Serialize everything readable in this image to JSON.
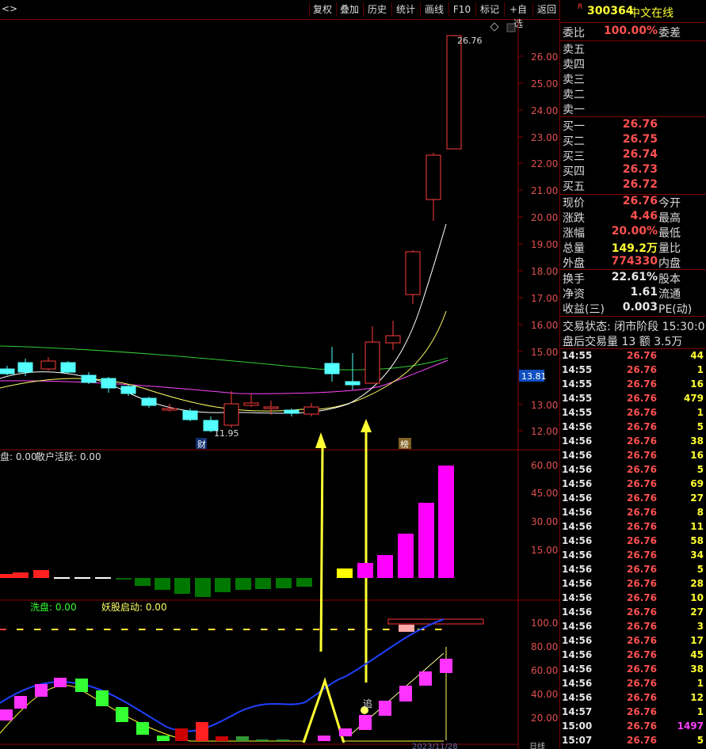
{
  "toolbar": {
    "nav_left": "<",
    "nav_right": ">",
    "buttons": [
      "复权",
      "叠加",
      "历史",
      "统计",
      "画线",
      "F10",
      "标记",
      "+自选",
      "返回"
    ]
  },
  "main_chart": {
    "price_axis": [
      "26.00",
      "25.00",
      "24.00",
      "23.00",
      "22.00",
      "21.00",
      "20.00",
      "19.00",
      "18.00",
      "17.00",
      "16.00",
      "15.00",
      "13.00",
      "12.00"
    ],
    "current_price_tag": "13.81",
    "high_label": "26.76",
    "low_label": "11.95",
    "marker_cai": "财",
    "marker_bang": "榜",
    "colors": {
      "up": "#ff3c3c",
      "down": "#54ffff",
      "ma5": "#ffffff",
      "ma10": "#ffff66",
      "ma20": "#ff44ff",
      "ma60": "#33cc33"
    }
  },
  "indicator1": {
    "label_a": "盘: 0.00",
    "label_b": "散户活跃: 0.00",
    "axis": [
      "60.00",
      "45.00",
      "30.00",
      "15.00"
    ]
  },
  "indicator2": {
    "label_a": "洗盘: 0.00",
    "label_b": "妖股启动: 0.00",
    "axis": [
      "100.0",
      "80.00",
      "60.00",
      "40.00",
      "20.00"
    ],
    "chase_label": "追",
    "date_fragment": "2023/11/28",
    "bottom_label": "日线"
  },
  "quote": {
    "code": "300364",
    "name": "中文在线",
    "r_mark": "R",
    "weibi_label": "委比",
    "weibi_value": "100.00%",
    "weicha_label": "委差",
    "sell": [
      {
        "label": "卖五",
        "price": ""
      },
      {
        "label": "卖四",
        "price": ""
      },
      {
        "label": "卖三",
        "price": ""
      },
      {
        "label": "卖二",
        "price": ""
      },
      {
        "label": "卖一",
        "price": ""
      }
    ],
    "buy": [
      {
        "label": "买一",
        "price": "26.76"
      },
      {
        "label": "买二",
        "price": "26.75"
      },
      {
        "label": "买三",
        "price": "26.74"
      },
      {
        "label": "买四",
        "price": "26.73"
      },
      {
        "label": "买五",
        "price": "26.72"
      }
    ],
    "stats": [
      {
        "label": "现价",
        "value": "26.76",
        "label2": "今开",
        "color": "#ff5050"
      },
      {
        "label": "涨跌",
        "value": "4.46",
        "label2": "最高",
        "color": "#ff5050"
      },
      {
        "label": "涨幅",
        "value": "20.00%",
        "label2": "最低",
        "color": "#ff5050"
      },
      {
        "label": "总量",
        "value": "149.2万",
        "label2": "量比",
        "color": "#ffff33"
      },
      {
        "label": "外盘",
        "value": "774330",
        "label2": "内盘",
        "color": "#ff5050"
      }
    ],
    "stats2": [
      {
        "label": "换手",
        "value": "22.61%",
        "label2": "股本",
        "color": "#e6e6e6"
      },
      {
        "label": "净资",
        "value": "1.61",
        "label2": "流通",
        "color": "#e6e6e6"
      },
      {
        "label": "收益(三)",
        "value": "0.003",
        "label2": "PE(动)",
        "color": "#e6e6e6"
      }
    ],
    "trade_status": "交易状态: 闭市阶段 15:30:0",
    "after_hours": "盘后交易量 13 额 3.5万"
  },
  "ticks": [
    {
      "time": "14:55",
      "price": "26.76",
      "vol": "44"
    },
    {
      "time": "14:55",
      "price": "26.76",
      "vol": "1"
    },
    {
      "time": "14:55",
      "price": "26.76",
      "vol": "16"
    },
    {
      "time": "14:55",
      "price": "26.76",
      "vol": "479"
    },
    {
      "time": "14:55",
      "price": "26.76",
      "vol": "1"
    },
    {
      "time": "14:56",
      "price": "26.76",
      "vol": "5"
    },
    {
      "time": "14:56",
      "price": "26.76",
      "vol": "38"
    },
    {
      "time": "14:56",
      "price": "26.76",
      "vol": "16"
    },
    {
      "time": "14:56",
      "price": "26.76",
      "vol": "5"
    },
    {
      "time": "14:56",
      "price": "26.76",
      "vol": "69"
    },
    {
      "time": "14:56",
      "price": "26.76",
      "vol": "27"
    },
    {
      "time": "14:56",
      "price": "26.76",
      "vol": "8"
    },
    {
      "time": "14:56",
      "price": "26.76",
      "vol": "11"
    },
    {
      "time": "14:56",
      "price": "26.76",
      "vol": "58"
    },
    {
      "time": "14:56",
      "price": "26.76",
      "vol": "34"
    },
    {
      "time": "14:56",
      "price": "26.76",
      "vol": "5"
    },
    {
      "time": "14:56",
      "price": "26.76",
      "vol": "28"
    },
    {
      "time": "14:56",
      "price": "26.76",
      "vol": "10"
    },
    {
      "time": "14:56",
      "price": "26.76",
      "vol": "27"
    },
    {
      "time": "14:56",
      "price": "26.76",
      "vol": "3"
    },
    {
      "time": "14:56",
      "price": "26.76",
      "vol": "17"
    },
    {
      "time": "14:56",
      "price": "26.76",
      "vol": "45"
    },
    {
      "time": "14:56",
      "price": "26.76",
      "vol": "38"
    },
    {
      "time": "14:56",
      "price": "26.76",
      "vol": "1"
    },
    {
      "time": "14:56",
      "price": "26.76",
      "vol": "12"
    },
    {
      "time": "14:57",
      "price": "26.76",
      "vol": "1"
    },
    {
      "time": "15:00",
      "price": "26.76",
      "vol": "1497"
    },
    {
      "time": "15:07",
      "price": "26.76",
      "vol": "5"
    }
  ]
}
